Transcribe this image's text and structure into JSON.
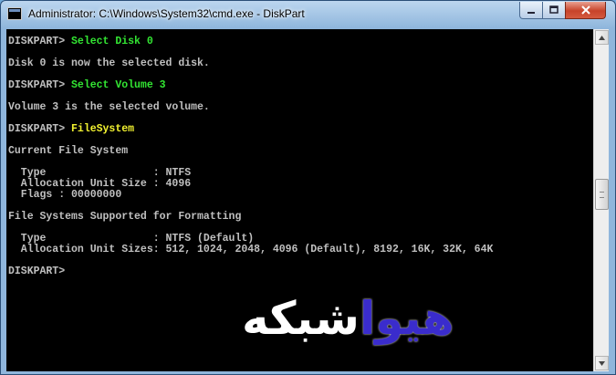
{
  "window": {
    "title": "Administrator: C:\\Windows\\System32\\cmd.exe - DiskPart",
    "controls": {
      "minimize_icon": "minimize-icon",
      "maximize_icon": "maximize-icon",
      "close_icon": "close-icon"
    }
  },
  "console": {
    "background_color": "#000000",
    "text_color": "#c0c0c0",
    "command_green": "#33e633",
    "command_yellow": "#f2f230",
    "lines": [
      {
        "prompt": "DISKPART> ",
        "command": "Select Disk 0"
      },
      {
        "text": ""
      },
      {
        "text": "Disk 0 is now the selected disk."
      },
      {
        "text": ""
      },
      {
        "prompt": "DISKPART> ",
        "command": "Select Volume 3"
      },
      {
        "text": ""
      },
      {
        "text": "Volume 3 is the selected volume."
      },
      {
        "text": ""
      },
      {
        "prompt": "DISKPART> ",
        "command": "FileSystem"
      },
      {
        "text": ""
      },
      {
        "text": "Current File System"
      },
      {
        "text": ""
      },
      {
        "text": "  Type                 : NTFS"
      },
      {
        "text": "  Allocation Unit Size : 4096"
      },
      {
        "text": "  Flags : 00000000"
      },
      {
        "text": ""
      },
      {
        "text": "File Systems Supported for Formatting"
      },
      {
        "text": ""
      },
      {
        "text": "  Type                 : NTFS (Default)"
      },
      {
        "text": "  Allocation Unit Sizes: 512, 1024, 2048, 4096 (Default), 8192, 16K, 32K, 64K"
      },
      {
        "text": ""
      },
      {
        "prompt": "DISKPART> ",
        "command": ""
      }
    ]
  },
  "watermark": {
    "part_white": "شبکه",
    "part_blue": "هیوا"
  },
  "scrollbar": {
    "up_icon": "up-arrow-icon",
    "down_icon": "down-arrow-icon",
    "position": 0.48
  }
}
